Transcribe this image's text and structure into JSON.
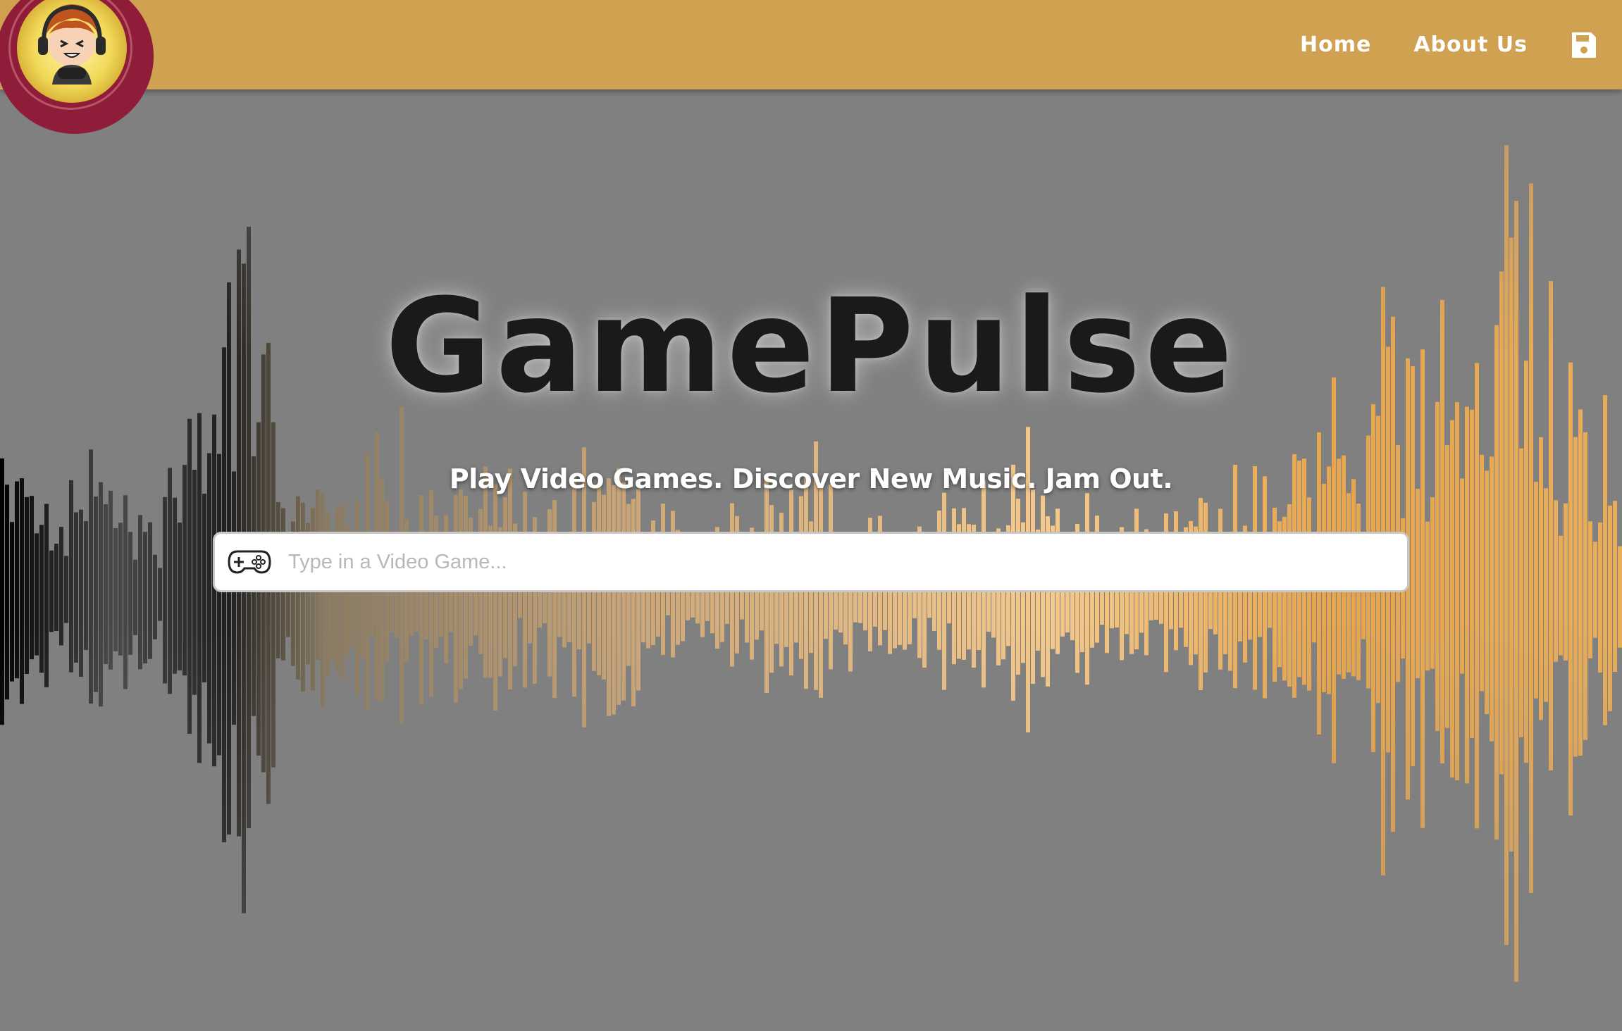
{
  "nav": {
    "logo_icon": "gamer-mascot-icon",
    "links": [
      {
        "label": "Home"
      },
      {
        "label": "About Us"
      }
    ],
    "save_icon": "floppy-disk-icon"
  },
  "hero": {
    "title": "GamePulse",
    "tagline": "Play Video Games. Discover New Music. Jam Out."
  },
  "search": {
    "icon": "gamepad-icon",
    "placeholder": "Type in a Video Game...",
    "value": ""
  },
  "colors": {
    "navbar": "#d0a150",
    "background": "#808080",
    "logo_ring": "#8f1c38",
    "title": "#1a1a1a",
    "wave_start": "#000000",
    "wave_mid": "#f3c784",
    "wave_end": "#e7a84f"
  }
}
